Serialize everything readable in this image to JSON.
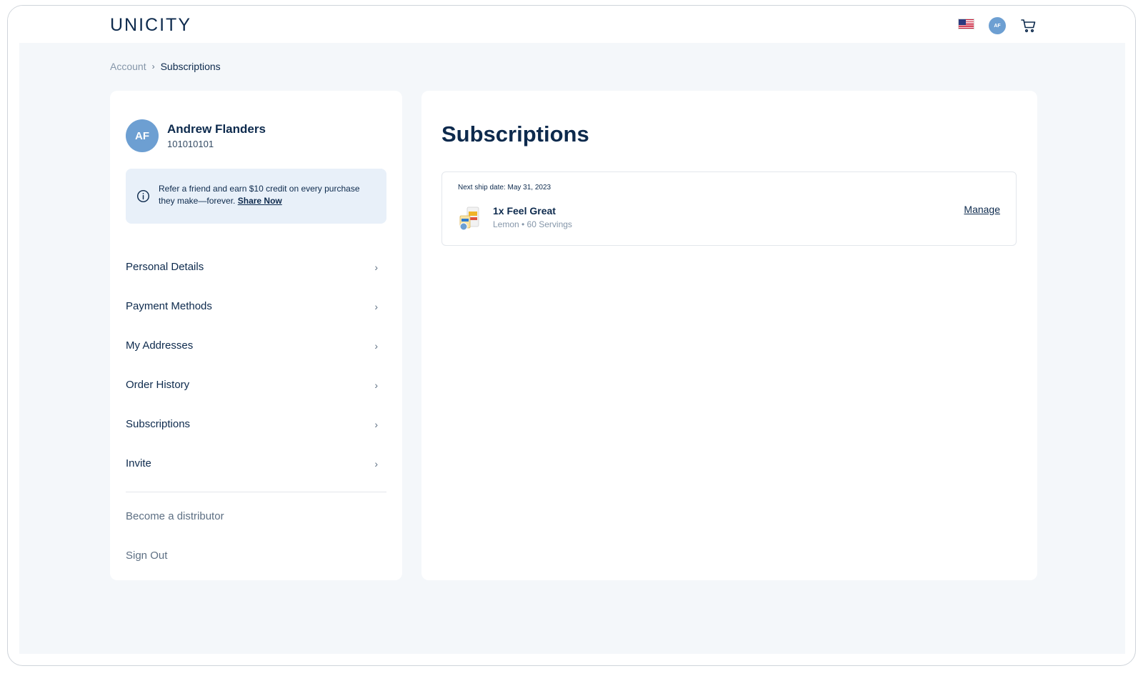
{
  "header": {
    "logo_text": "UNICITY",
    "avatar_initials": "AF",
    "flag_icon": "us-flag-icon",
    "cart_icon": "cart-icon"
  },
  "breadcrumb": {
    "items": [
      "Account",
      "Subscriptions"
    ]
  },
  "profile": {
    "initials": "AF",
    "name": "Andrew Flanders",
    "id": "101010101"
  },
  "refer": {
    "text": "Refer a friend and earn $10 credit on every purchase they make—forever.",
    "link_label": "Share Now"
  },
  "nav": {
    "items": [
      {
        "label": "Personal Details"
      },
      {
        "label": "Payment Methods"
      },
      {
        "label": "My Addresses"
      },
      {
        "label": "Order History"
      },
      {
        "label": "Subscriptions"
      },
      {
        "label": "Invite"
      }
    ],
    "secondary": [
      {
        "label": "Become a distributor"
      },
      {
        "label": "Sign Out"
      }
    ]
  },
  "main": {
    "title": "Subscriptions",
    "subscription": {
      "next_ship": "Next ship date: May 31, 2023",
      "product_name": "1x Feel Great",
      "product_meta": "Lemon • 60 Servings",
      "manage_label": "Manage"
    }
  },
  "colors": {
    "navy": "#0d2a4d",
    "avatar_blue": "#6d9fd2",
    "page_bg": "#f4f7fa",
    "refer_bg": "#e8f0f9",
    "muted": "#5d6f83"
  }
}
